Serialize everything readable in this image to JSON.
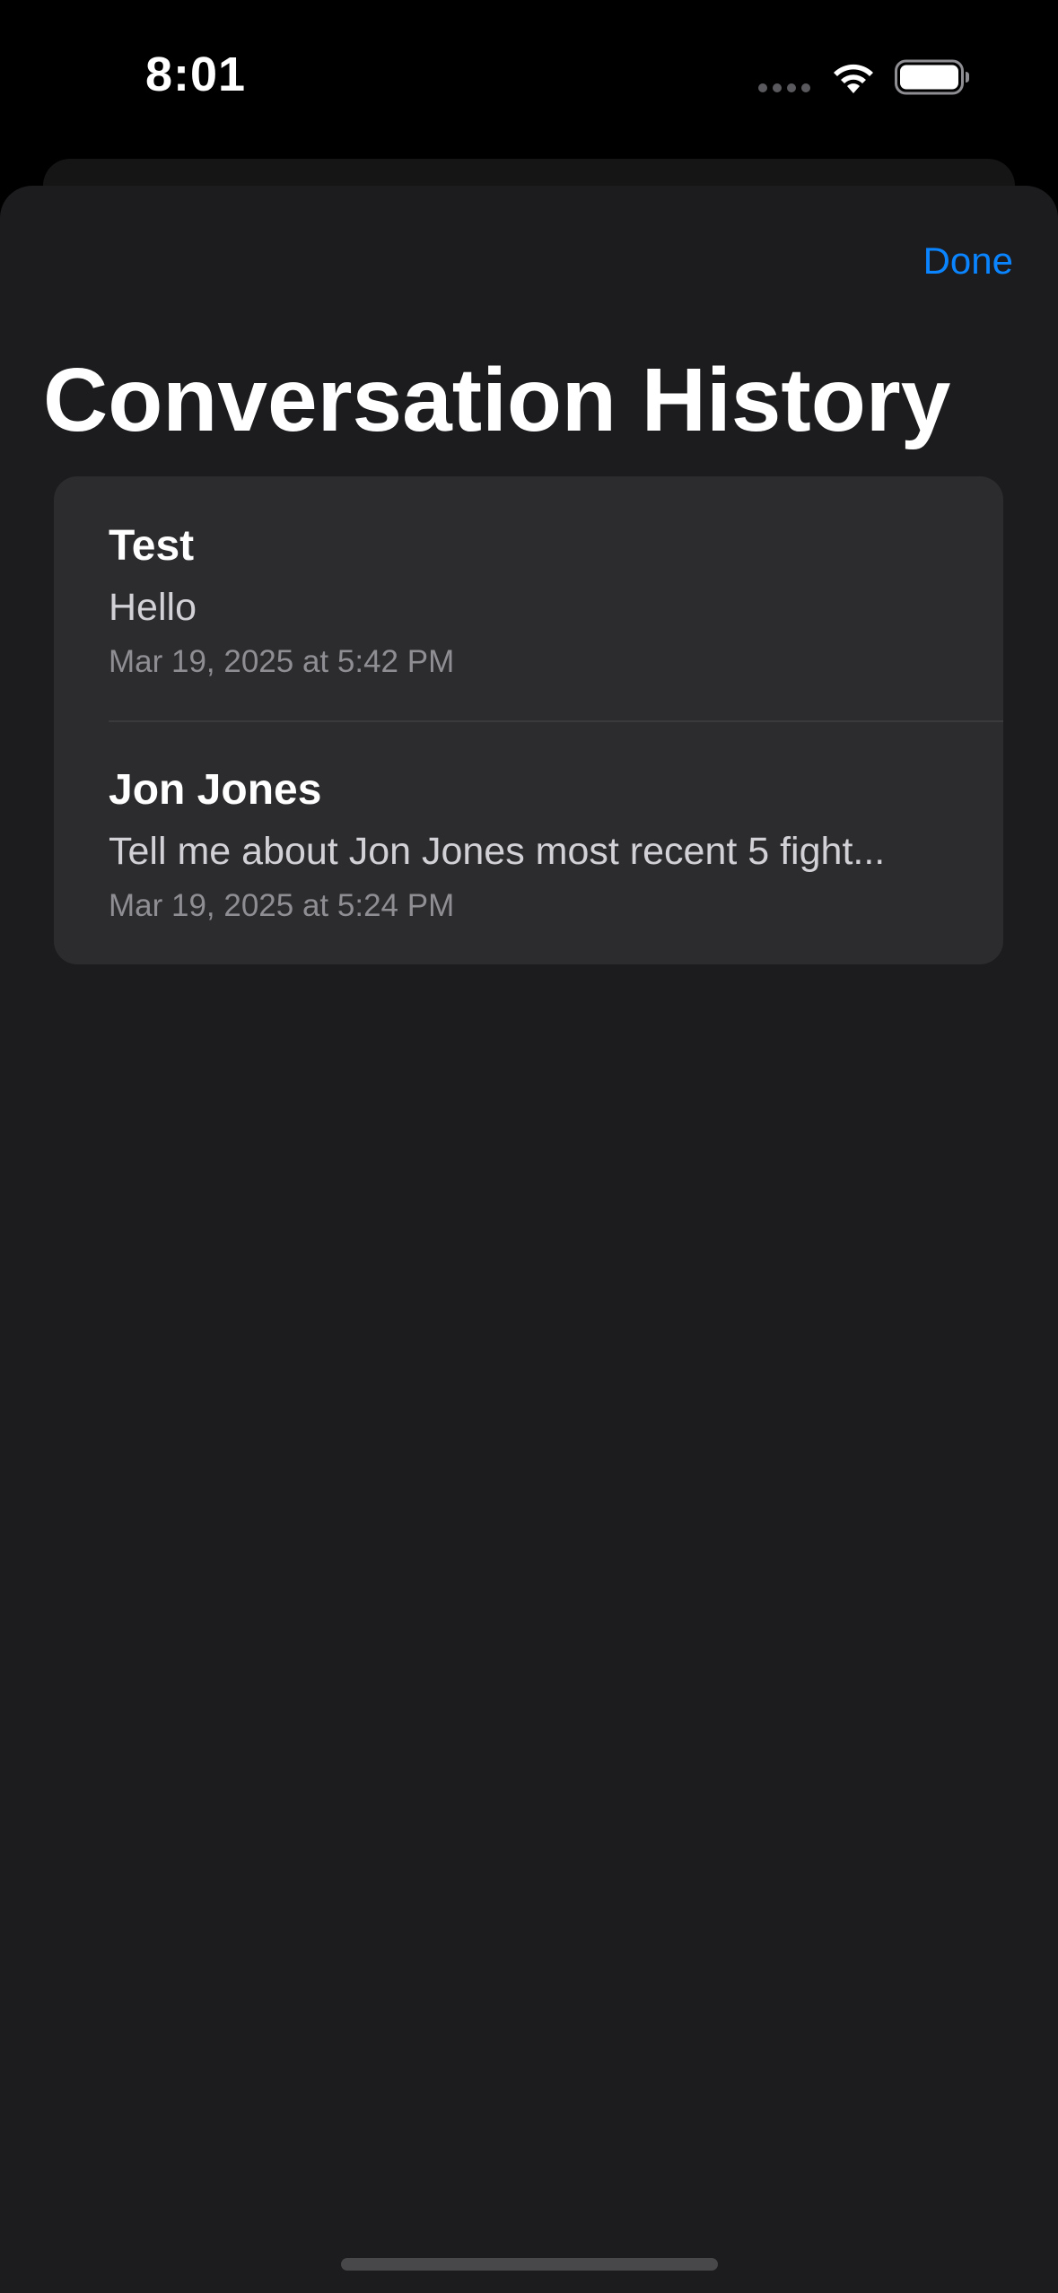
{
  "status_bar": {
    "time": "8:01",
    "icons": [
      "cellular-signal-icon",
      "wifi-icon",
      "battery-icon"
    ]
  },
  "colors": {
    "accent": "#0a84ff",
    "sheet_background": "#1c1c1e",
    "list_background": "#2c2c2e",
    "secondary_text": "#8e8e93"
  },
  "sheet": {
    "done_label": "Done",
    "title": "Conversation History"
  },
  "conversations": [
    {
      "title": "Test",
      "preview": "Hello",
      "date": "Mar 19, 2025 at 5:42 PM"
    },
    {
      "title": "Jon Jones",
      "preview": "Tell me about Jon Jones most recent 5 fight...",
      "date": "Mar 19, 2025 at 5:24 PM"
    }
  ]
}
